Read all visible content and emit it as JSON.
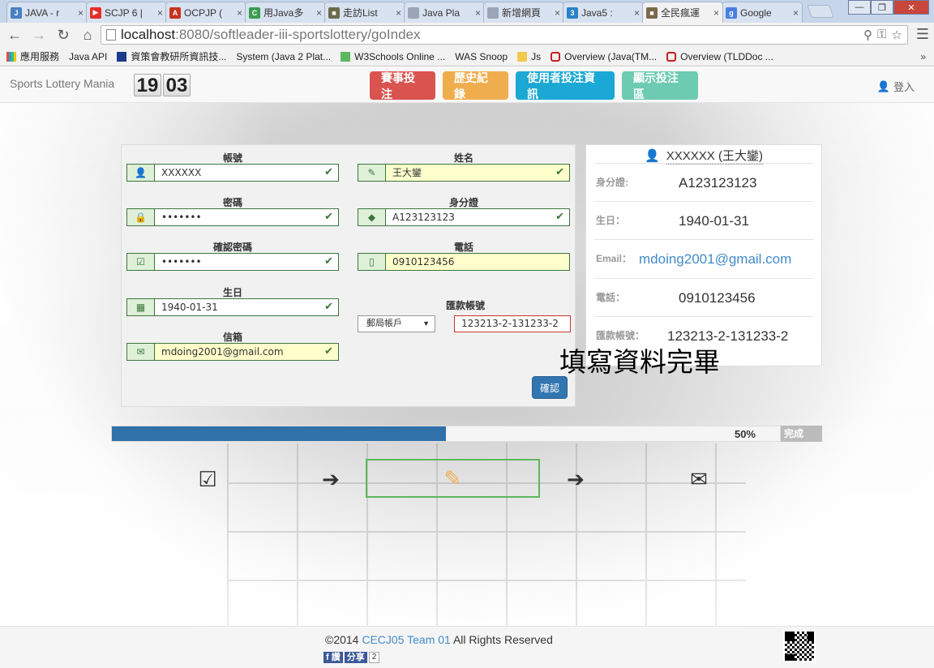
{
  "browser": {
    "tabs": [
      {
        "label": "JAVA - r",
        "icon": "blue-page-icon",
        "color": "#4a7fc1",
        "glyph": "J"
      },
      {
        "label": "SCJP 6 |",
        "icon": "youtube-icon",
        "color": "#e52d27",
        "glyph": "▶"
      },
      {
        "label": "OCPJP (",
        "icon": "pdf-icon",
        "color": "#c8321e",
        "glyph": "A"
      },
      {
        "label": "用Java多",
        "icon": "green-c-icon",
        "color": "#3a9c52",
        "glyph": "C"
      },
      {
        "label": "走訪List",
        "icon": "image-icon",
        "color": "#6b6b4c",
        "glyph": "■"
      },
      {
        "label": "Java Pla",
        "icon": "page-icon",
        "color": "#9aa6b8",
        "glyph": ""
      },
      {
        "label": "新增網頁",
        "icon": "page-icon",
        "color": "#9aa6b8",
        "glyph": ""
      },
      {
        "label": "Java5 :",
        "icon": "blue-3-icon",
        "color": "#2a82c9",
        "glyph": "3"
      },
      {
        "label": "全民瘋運",
        "icon": "site-icon",
        "color": "#7a6a4a",
        "glyph": "■",
        "active": true
      },
      {
        "label": "Google",
        "icon": "google-icon",
        "color": "#4a7fe0",
        "glyph": "g"
      }
    ],
    "url_host": "localhost",
    "url_rest": ":8080/softleader-iii-sportslottery/goIndex",
    "bookmarks": [
      {
        "label": "應用服務",
        "icon": "apps"
      },
      {
        "label": "Java API",
        "icon": "page"
      },
      {
        "label": "資策會教研所資訊技...",
        "icon": "gov"
      },
      {
        "label": "System (Java 2 Plat...",
        "icon": "page"
      },
      {
        "label": "W3Schools Online ...",
        "icon": "w3"
      },
      {
        "label": "WAS Snoop",
        "icon": "page"
      },
      {
        "label": "Js",
        "icon": "folder"
      },
      {
        "label": "Overview (Java(TM...",
        "icon": "oracle"
      },
      {
        "label": "Overview (TLDDoc ...",
        "icon": "oracle"
      }
    ],
    "bookmarks_more": "»"
  },
  "navbar": {
    "brand": "Sports Lottery Mania",
    "clock_hours": "19",
    "clock_minutes": "03",
    "buttons": [
      "賽事投注",
      "歷史紀錄",
      "使用者投注資訊",
      "顯示投注區"
    ],
    "login": "登入"
  },
  "form": {
    "account_label": "帳號",
    "account_value": "XXXXXX",
    "name_label": "姓名",
    "name_value": "王大鑾",
    "password_label": "密碼",
    "password_value": "•••••••",
    "id_label": "身分證",
    "id_value": "A123123123",
    "confirm_password_label": "確認密碼",
    "confirm_password_value": "•••••••",
    "phone_label": "電話",
    "phone_value": "0910123456",
    "birthday_label": "生日",
    "birthday_value": "1940-01-31",
    "bank_label": "匯款帳號",
    "bank_type": "郵局帳戶",
    "bank_value": "123213-2-131233-2",
    "email_label": "信箱",
    "email_value": "mdoing2001@gmail.com",
    "confirm_button": "確認"
  },
  "summary": {
    "username": "XXXXXX (王大鑾)",
    "rows": [
      {
        "key": "身分證:",
        "value": "A123123123"
      },
      {
        "key": "生日：",
        "value": "1940-01-31"
      },
      {
        "key": "Email：",
        "value": "mdoing2001@gmail.com"
      },
      {
        "key": "電話：",
        "value": "0910123456"
      },
      {
        "key": "匯款帳號：",
        "value": "123213-2-131233-2"
      }
    ]
  },
  "overlay_text": "填寫資料完畢",
  "progress": {
    "percent": 50,
    "label": "50%",
    "done_label": "完成"
  },
  "steps": [
    "check-square-icon",
    "arrow-right-icon",
    "pencil-icon",
    "arrow-right-icon",
    "envelope-icon"
  ],
  "footer": {
    "copyright_prefix": "©2014 ",
    "team": "CECJ05 Team 01",
    "copyright_suffix": " All Rights Reserved",
    "like": "f 讚",
    "share": "分享",
    "share_count": "2"
  },
  "colors": {
    "btn_red": "#d9534f",
    "btn_orange": "#f0ad4e",
    "btn_blue": "#1ba8d4",
    "btn_teal": "#6ccbb0",
    "success_green": "#3c763d",
    "primary": "#3071a9",
    "link": "#428bca"
  }
}
